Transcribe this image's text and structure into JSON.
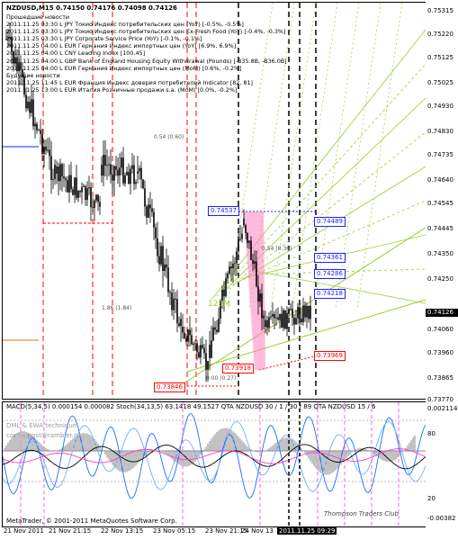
{
  "main_chart": {
    "title": "NZDUSD,M15  0.74150 0.74176 0.74098 0.74126",
    "news": [
      "Прошедшие новости",
      "2011.11.25 03:30 L JPY Токио Индекс потребительских цен (YoY) [-0.5%, -0.5%]",
      "2011.11.25 03:30 L JPY Токио Индекс потребительских цен Ex-Fresh Food (YoY) [-0.4%, -0.3%]",
      "2011.11.25 03:30 L JPY Corporate Service Price (YoY) [-0.1%, -0.1%]",
      "2011.11.25 04:00 L EUR Германия Индекс импортных цен (YoY) [6.9%, 6.9%]",
      "2011.11.25 04:00 L CNY Leading Index [100.45]",
      "2011.11.25 04:00 L GBP Bank of England Housing Equity Withdrawal (Pounds) [-B35.8B, -B36.0B]",
      "2011.11.25 04:00 L EUR Германия Индекс импортных цен (MoM) [0.6%, -0.2%]",
      "Будущие новости",
      "2011.11.25 11:45 L EUR Франция Индекс доверия потребителей Indicator [82, 81]",
      "2011.11.25 13:00 L EUR Италия Розничные продажи s.a. (MoM) [0.0%, -0.2%]"
    ],
    "price_tags": {
      "blue": [
        {
          "label": "0.74537"
        },
        {
          "label": "0.74489"
        },
        {
          "label": "0.74361"
        },
        {
          "label": "0.74286"
        },
        {
          "label": "0.74218"
        }
      ],
      "red": [
        {
          "label": "0.73918"
        },
        {
          "label": "0.73969"
        },
        {
          "label": "0.73846"
        }
      ]
    },
    "small_labels": [
      "0.54 (0.60)",
      "1.86 (1.84)",
      "0.54 (0.36)",
      "0.00 (0.27)",
      "123M"
    ]
  },
  "price_axis": {
    "labels": [
      "0.75315",
      "0.75220",
      "0.75125",
      "0.75025",
      "0.74930",
      "0.74830",
      "0.74735",
      "0.74640",
      "0.74545",
      "0.74445",
      "0.74350",
      "0.74250",
      "0.74126",
      "0.74060",
      "0.73960",
      "0.73865",
      "0.73770"
    ],
    "current": "0.74126"
  },
  "sub_chart": {
    "title": "MACD(5,34,5) 0.000154 0.000082  Stoch(34,13,5) 63.1418 49.1527  QTA NZDUSD 30 / 1 / 30 / 89  QTA NZDUSD 15 / 6",
    "overlay_lines": [
      "DML & EWA technique",
      "cornik-post@rambler.ru"
    ],
    "axis_labels": [
      "0.002114",
      "80",
      "20",
      "-0.00382"
    ],
    "copyright": "MetaTrader, © 2001-2011 MetaQuotes Software Corp.",
    "watermark": "Thompson Traders Club"
  },
  "time_axis": {
    "labels": [
      "21 Nov 2011",
      "21 Nov 21:15",
      "22 Nov 13:15",
      "23 Nov 05:15",
      "23 Nov 21:15",
      "24 Nov 13"
    ],
    "current": "2011.11.25 09:29"
  },
  "colors": {
    "candles": "#000000",
    "fib": "#9acd32",
    "pink_band": "#ff7fbf",
    "red_level": "#ff0000",
    "blue_level": "#1d1dff"
  }
}
